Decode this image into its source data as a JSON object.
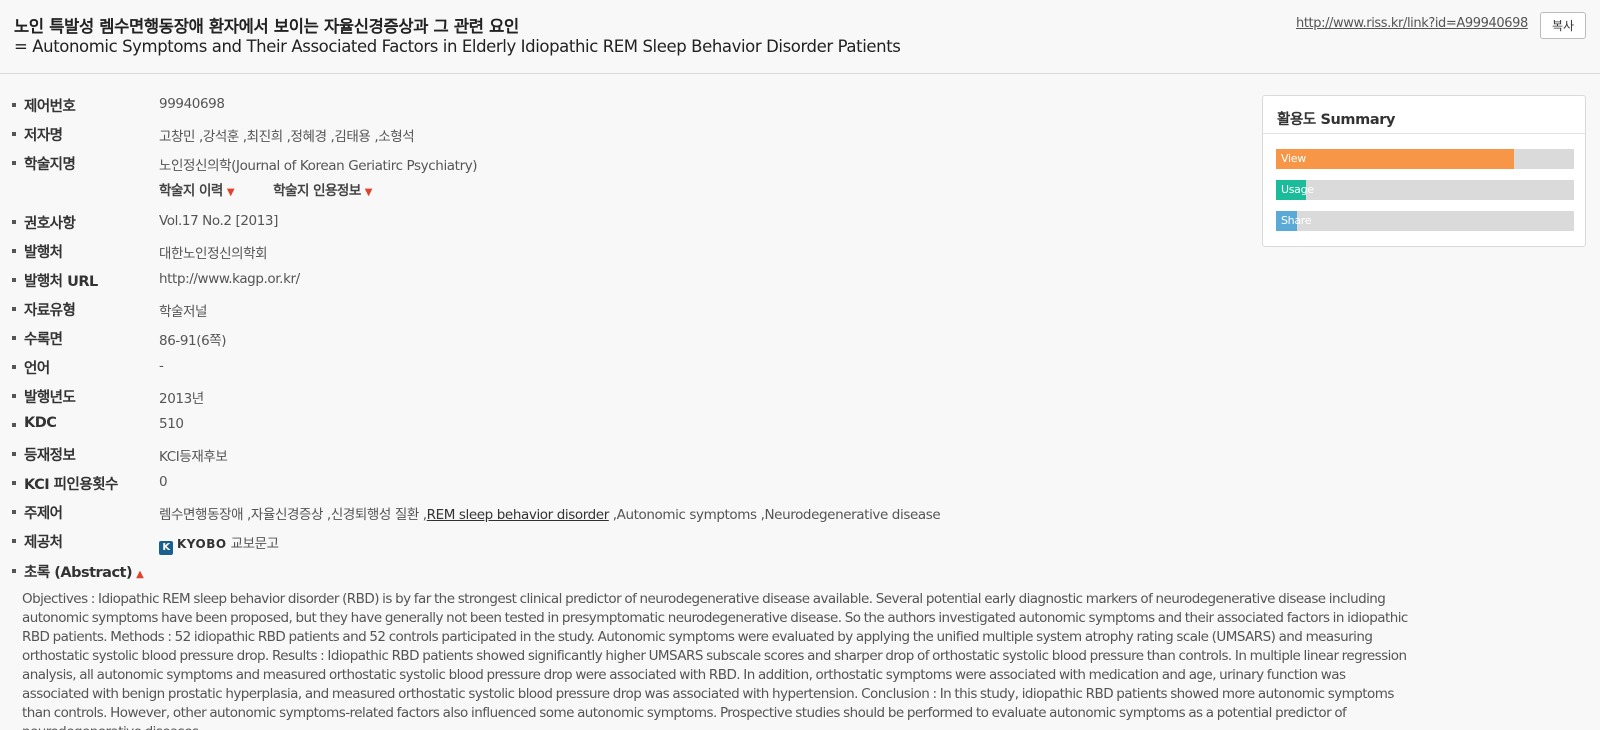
{
  "header": {
    "title_ko": "노인 특발성 렘수면행동장애 환자에서 보이는 자율신경증상과 그 관련 요인",
    "title_en": "= Autonomic Symptoms and Their Associated Factors in Elderly Idiopathic REM Sleep Behavior Disorder Patients",
    "link_url": "http://www.riss.kr/link?id=A99940698",
    "copy_label": "복사"
  },
  "fields": {
    "control_no": {
      "label": "제어번호",
      "value": "99940698"
    },
    "authors": {
      "label": "저자명",
      "value": "고창민 ,강석훈 ,최진희 ,정혜경 ,김태용 ,소형석"
    },
    "journal": {
      "label": "학술지명",
      "value": "노인정신의학(Journal of Korean Geriatirc Psychiatry)"
    },
    "volume": {
      "label": "권호사항",
      "value": "Vol.17 No.2 [2013]"
    },
    "publisher": {
      "label": "발행처",
      "value": "대한노인정신의학회"
    },
    "publisher_url": {
      "label": "발행처 URL",
      "value": "http://www.kagp.or.kr/"
    },
    "doc_type": {
      "label": "자료유형",
      "value": "학술저널"
    },
    "pages": {
      "label": "수록면",
      "value": "86-91(6쪽)"
    },
    "language": {
      "label": "언어",
      "value": "-"
    },
    "year": {
      "label": "발행년도",
      "value": "2013년"
    },
    "kdc": {
      "label": "KDC",
      "value": "510"
    },
    "registration": {
      "label": "등재정보",
      "value": "KCI등재후보"
    },
    "kci_citations": {
      "label": "KCI 피인용횟수",
      "value": "0"
    },
    "keywords": {
      "label": "주제어",
      "before": "렘수면행동장애 ,자율신경증상 ,신경퇴행성 질환 ,",
      "link": "REM sleep behavior disorder",
      "after": " ,Autonomic symptoms ,Neurodegenerative disease"
    },
    "provider": {
      "label": "제공처",
      "badge": "K",
      "brand": "KYOBO",
      "value": "교보문고"
    }
  },
  "journal_links": {
    "history": "학술지 이력",
    "citation": "학술지 인용정보",
    "arrow": "▼"
  },
  "abstract": {
    "label": "초록 (Abstract)",
    "arrow": "▲",
    "text": "Objectives : Idiopathic REM sleep behavior disorder (RBD) is by far the strongest clinical predictor of neurodegenerative disease available. Several potential early diagnostic markers of neurodegenerative disease including autonomic symptoms have been proposed, but they have generally not been tested in presymptomatic neurodegenerative disease. So the authors investigated autonomic symptoms and their associated factors in idiopathic RBD patients. Methods : 52 idiopathic RBD patients and 52 controls participated in the study. Autonomic symptoms were evaluated by applying the unified multiple system atrophy rating scale (UMSARS) and measuring orthostatic systolic blood pressure drop. Results : Idiopathic RBD patients showed significantly higher UMSARS subscale scores and sharper drop of orthostatic systolic blood pressure than controls. In multiple linear regression analysis, all autonomic symptoms and measured orthostatic systolic blood pressure drop were associated with RBD. In addition, orthostatic symptoms were associated with medication and age, urinary function was associated with benign prostatic hyperplasia, and measured orthostatic systolic blood pressure drop was associated with hypertension. Conclusion : In this study, idiopathic RBD patients showed more autonomic symptoms than controls. However, other autonomic symptoms-related factors also influenced some autonomic symptoms. Prospective studies should be performed to evaluate autonomic symptoms as a potential predictor of neurodegenerative diseases."
  },
  "summary": {
    "title": "활용도 Summary",
    "bars": [
      {
        "label": "View",
        "fraction": 0.8,
        "color": "#f79646"
      },
      {
        "label": "Usage",
        "fraction": 0.1,
        "color": "#1bbc9b"
      },
      {
        "label": "Share",
        "fraction": 0.07,
        "color": "#5aa9d6"
      }
    ]
  }
}
